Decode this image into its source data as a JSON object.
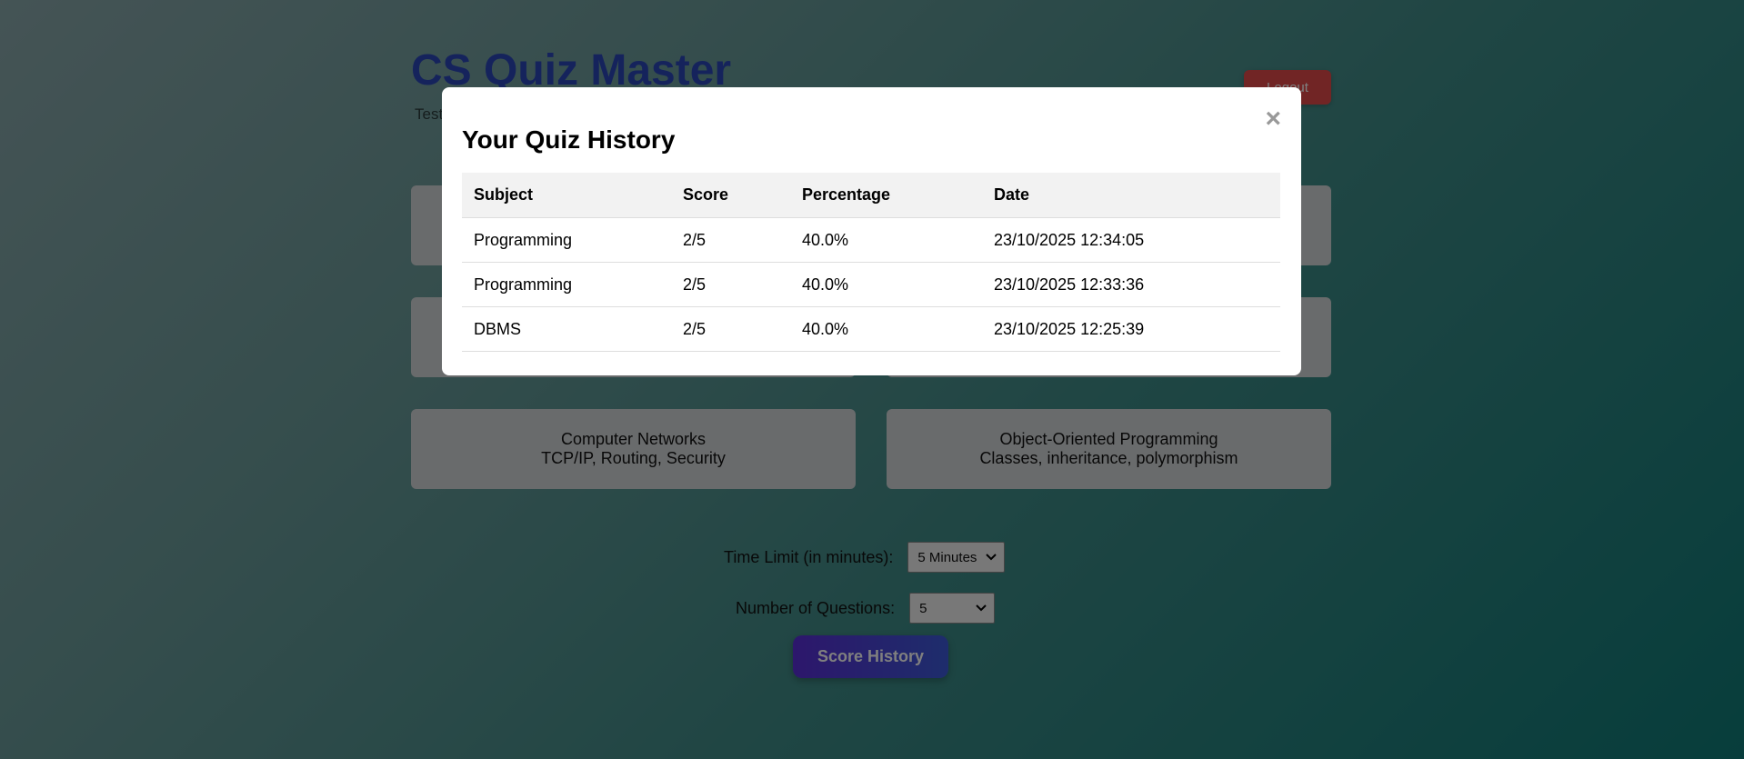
{
  "app": {
    "title": "CS Quiz Master",
    "subtitle": "Test",
    "logout_label": "Logout"
  },
  "subjects": [
    {
      "name": "",
      "desc": ""
    },
    {
      "name": "",
      "desc": ""
    },
    {
      "name": "",
      "desc": ""
    },
    {
      "name": "",
      "desc": ""
    },
    {
      "name": "Computer Networks",
      "desc": "TCP/IP, Routing, Security"
    },
    {
      "name": "Object-Oriented Programming",
      "desc": "Classes, inheritance, polymorphism"
    }
  ],
  "options": {
    "time_label": "Time Limit (in minutes):",
    "time_value": "5 Minutes",
    "questions_label": "Number of Questions:",
    "questions_value": "5"
  },
  "score_history_label": "Score History",
  "modal": {
    "title": "Your Quiz History",
    "close_symbol": "×",
    "headers": [
      "Subject",
      "Score",
      "Percentage",
      "Date"
    ],
    "rows": [
      [
        "Programming",
        "2/5",
        "40.0%",
        "23/10/2025 12:34:05"
      ],
      [
        "Programming",
        "2/5",
        "40.0%",
        "23/10/2025 12:33:36"
      ],
      [
        "DBMS",
        "2/5",
        "40.0%",
        "23/10/2025 12:25:39"
      ]
    ]
  },
  "colors": {
    "title_blue": "#2a47b8",
    "logout_red": "#e24a4a",
    "button_purple": "#5a2ed8"
  }
}
